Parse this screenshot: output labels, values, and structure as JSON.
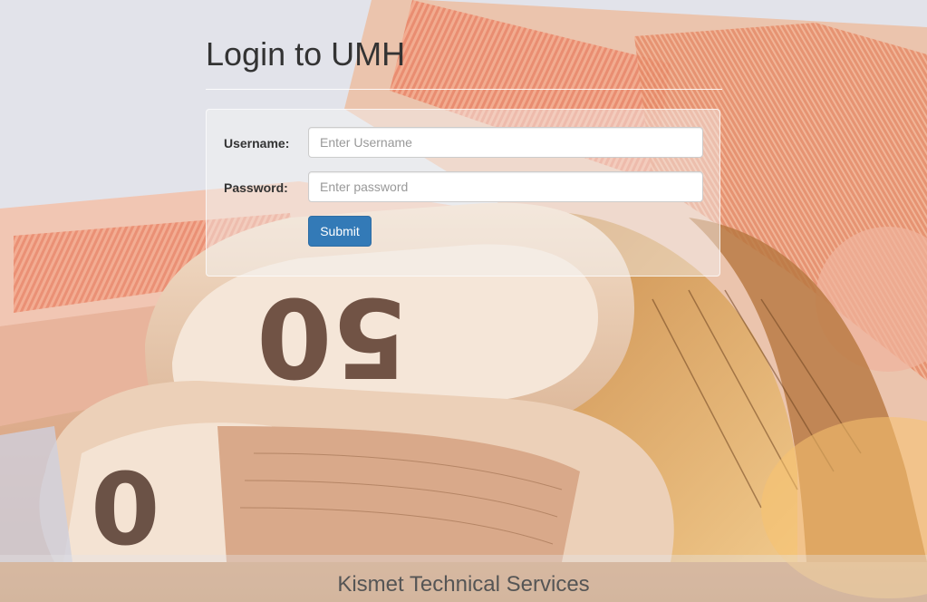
{
  "page": {
    "title": "Login to UMH"
  },
  "login_form": {
    "username_label": "Username:",
    "username_value": "",
    "username_placeholder": "Enter Username",
    "password_label": "Password:",
    "password_value": "",
    "password_placeholder": "Enter password",
    "submit_label": "Submit"
  },
  "footer": {
    "company": "Kismet Technical Services"
  },
  "colors": {
    "primary_button": "#337ab7",
    "title_text": "#333333",
    "footer_text": "#555555"
  },
  "background": {
    "subject": "rolled-euro-banknotes-photo"
  }
}
